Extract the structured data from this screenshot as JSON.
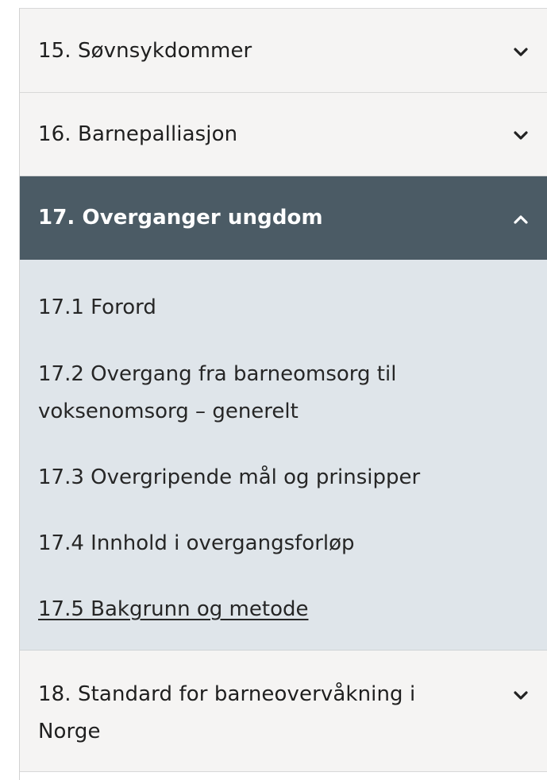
{
  "sections": [
    {
      "label": "15. Søvnsykdommer",
      "icon": "chevron-down-icon"
    },
    {
      "label": "16. Barnepalliasjon",
      "icon": "chevron-down-icon"
    },
    {
      "label": "17. Overganger ungdom",
      "icon": "chevron-up-icon"
    },
    {
      "label_line1": "18. Standard for barneovervåkning i",
      "label_line2": "Norge",
      "icon": "chevron-down-icon"
    }
  ],
  "subsections": [
    {
      "label": "17.1 Forord"
    },
    {
      "label_line1": "17.2 Overgang fra barneomsorg til",
      "label_line2": "voksenomsorg – generelt"
    },
    {
      "label": "17.3 Overgripende mål og prinsipper"
    },
    {
      "label": "17.4 Innhold i overgangsforløp"
    },
    {
      "label": "17.5 Bakgrunn og metode"
    }
  ],
  "colors": {
    "expanded_header": "#4b5b65",
    "expanded_body": "#dfe5ea",
    "collapsed_bg": "#f5f4f3"
  }
}
